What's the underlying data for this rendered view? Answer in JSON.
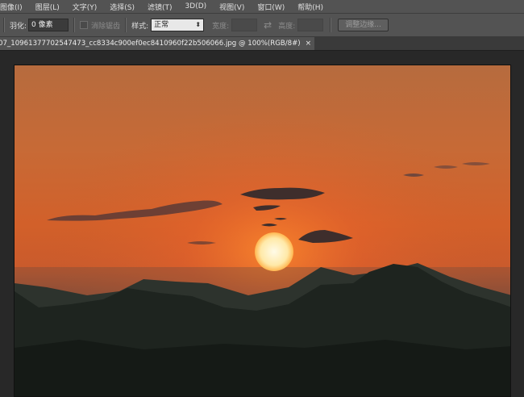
{
  "menu": [
    "图像(I)",
    "图层(L)",
    "文字(Y)",
    "选择(S)",
    "滤镜(T)",
    "3D(D)",
    "视图(V)",
    "窗口(W)",
    "帮助(H)"
  ],
  "options": {
    "feather_label": "羽化:",
    "feather_value": "0 像素",
    "antialias_label": "消除锯齿",
    "style_label": "样式:",
    "style_value": "正常",
    "width_label": "宽度:",
    "height_label": "高度:",
    "refine_edge_button": "调整边缘..."
  },
  "document": {
    "tab_title": "07_10961377702547473_cc8334c900ef0ec8410960f22b506066.jpg @ 100%(RGB/8#)",
    "close_glyph": "×"
  },
  "colors": {
    "sky_top": "#b86a3c",
    "sky_mid": "#d0622c",
    "sun": "#fff6d8",
    "mountains": "#1f2620"
  }
}
